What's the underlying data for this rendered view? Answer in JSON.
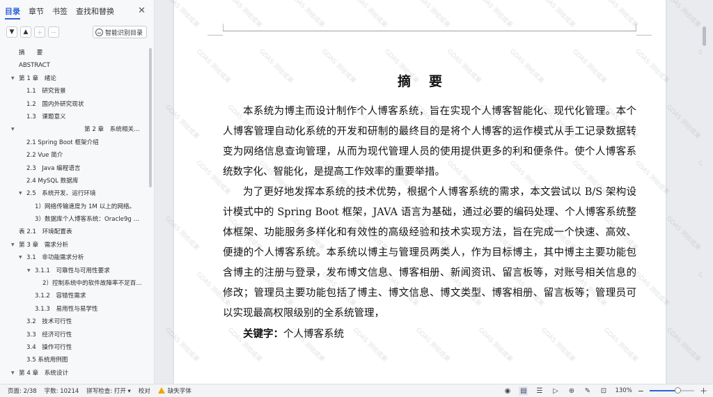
{
  "nav": {
    "tabs": [
      "目录",
      "章节",
      "书签",
      "查找和替换"
    ],
    "active_tab": 0,
    "close_icon": "close-icon",
    "tools": {
      "expand_icon": "chevron-down-icon",
      "collapse_icon": "chevron-up-icon",
      "add_icon": "plus-icon",
      "remove_icon": "minus-icon",
      "smart_label": "智能识别目录"
    },
    "toc": [
      {
        "label": "摘　　要",
        "level": 1,
        "arrow": false
      },
      {
        "label": "ABSTRACT",
        "level": 1,
        "arrow": false
      },
      {
        "label": "第 1 章　绪论",
        "level": 1,
        "arrow": true
      },
      {
        "label": "1.1　研究背景",
        "level": 2,
        "arrow": false
      },
      {
        "label": "1.2　国内外研究现状",
        "level": 2,
        "arrow": false
      },
      {
        "label": "1.3　课题意义",
        "level": 2,
        "arrow": false
      },
      {
        "label": "第 2 章　系统相关技...",
        "level": 1,
        "arrow": true,
        "centered": true
      },
      {
        "label": "2.1 Spring Boot 框架介绍",
        "level": 2,
        "arrow": false
      },
      {
        "label": "2.2 Vue 简介",
        "level": 2,
        "arrow": false
      },
      {
        "label": "2.3　Java 编程语言",
        "level": 2,
        "arrow": false
      },
      {
        "label": "2.4 MySQL 数据库",
        "level": 2,
        "arrow": false
      },
      {
        "label": "2.5　系统开发、运行环境",
        "level": 2,
        "arrow": true
      },
      {
        "label": "1）网络传输速度为 1M 以上的网络。",
        "level": 3,
        "arrow": false
      },
      {
        "label": "3）数据库个人博客系统：Oracle9g 或...",
        "level": 3,
        "arrow": false
      },
      {
        "label": "表 2.1　环境配置表",
        "level": 1,
        "arrow": false
      },
      {
        "label": "第 3 章　需求分析",
        "level": 1,
        "arrow": true
      },
      {
        "label": "3.1　非功能需求分析",
        "level": 2,
        "arrow": true
      },
      {
        "label": "3.1.1　可靠性与可用性要求",
        "level": 3,
        "arrow": true
      },
      {
        "label": "2）控制系统中的软件故障率不足百...",
        "level": 4,
        "arrow": false
      },
      {
        "label": "3.1.2　容错性需求",
        "level": 3,
        "arrow": false
      },
      {
        "label": "3.1.3　易用性与易学性",
        "level": 3,
        "arrow": false
      },
      {
        "label": "3.2　技术可行性",
        "level": 2,
        "arrow": false
      },
      {
        "label": "3.3　经济可行性",
        "level": 2,
        "arrow": false
      },
      {
        "label": "3.4　操作可行性",
        "level": 2,
        "arrow": false
      },
      {
        "label": "3.5 系统用例图",
        "level": 2,
        "arrow": false
      },
      {
        "label": "第 4 章　系统设计",
        "level": 1,
        "arrow": true
      }
    ]
  },
  "document": {
    "title": "摘要",
    "paragraphs": [
      "本系统为博主而设计制作个人博客系统，旨在实现个人博客智能化、现代化管理。本个人博客管理自动化系统的开发和研制的最终目的是将个人博客的运作模式从手工记录数据转变为网络信息查询管理，从而为现代管理人员的使用提供更多的利和便条件。使个人博客系统数字化、智能化，是提高工作效率的重要举措。",
      "为了更好地发挥本系统的技术优势，根据个人博客系统的需求，本文尝试以 B/S 架构设计模式中的 Spring Boot 框架，JAVA 语言为基础，通过必要的编码处理、个人博客系统整体框架、功能服务多样化和有效性的高级经验和技术实现方法，旨在完成一个快速、高效、便捷的个人博客系统。本系统以博主与管理员两类人，作为目标博主，其中博主主要功能包含博主的注册与登录，发布博文信息、博客相册、新闻资讯、留言板等，对账号相关信息的修改；管理员主要功能包括了博主、博文信息、博文类型、博客相册、留言板等；管理员可以实现最高权限级别的全系统管理，"
    ],
    "keywords_label": "关键字：",
    "keywords": "个人博客系统",
    "watermark": "GDAS 测绘成果"
  },
  "status": {
    "page": "页面: 2/38",
    "words": "字数: 10214",
    "spell": "拼写检查: 打开 ▾",
    "proof": "校对",
    "missing_font": "缺失字体",
    "zoom": "130%",
    "zoom_level_fraction": 0.62
  }
}
